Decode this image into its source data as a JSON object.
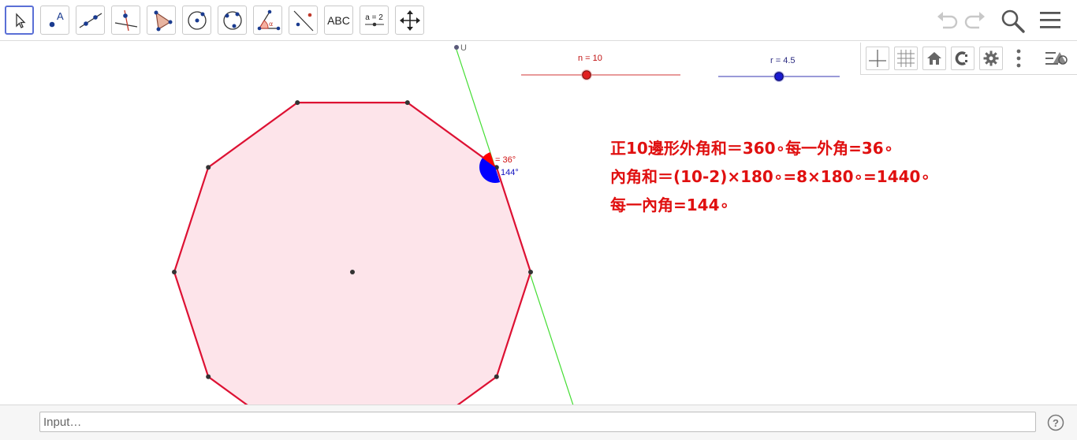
{
  "toolbar": {
    "tools": [
      {
        "name": "move-tool"
      },
      {
        "name": "point-tool",
        "glyph": "A"
      },
      {
        "name": "line-tool"
      },
      {
        "name": "perpendicular-line-tool"
      },
      {
        "name": "polygon-tool"
      },
      {
        "name": "circle-center-point-tool"
      },
      {
        "name": "circle-three-points-tool"
      },
      {
        "name": "angle-tool",
        "glyph": "α"
      },
      {
        "name": "reflect-tool"
      },
      {
        "name": "text-tool",
        "label": "ABC"
      },
      {
        "name": "slider-tool",
        "label": "a = 2"
      },
      {
        "name": "move-graphics-view-tool"
      }
    ],
    "undo_icon": "undo-icon",
    "redo_icon": "redo-icon",
    "search_icon": "search-icon",
    "menu_icon": "menu-icon"
  },
  "stylebar": {
    "buttons": [
      "axes-icon",
      "grid-icon",
      "home-icon",
      "point-capturing-icon",
      "gear-icon",
      "more-icon",
      "toggle-views-icon"
    ]
  },
  "sliders": [
    {
      "label": "n = 10",
      "value": 10,
      "color": "#e02020"
    },
    {
      "label": "r = 4.5",
      "value": 4.5,
      "color": "#1a1ad0"
    }
  ],
  "geometry": {
    "polygon_sides": 10,
    "fill_color": "#fde4ea",
    "edge_color": "#dd1133",
    "tangent_line_color": "#44dd33",
    "line_point_label": "U",
    "exterior_angle_label": "= 36°",
    "interior_angle_label": "144°",
    "exterior_angle_color": "#ff0000",
    "interior_angle_color": "#0000ff"
  },
  "notes": {
    "line1": "正10邊形外角和＝360∘每一外角=36∘",
    "line2": "內角和＝(10-2)×180∘=8×180∘=1440∘",
    "line3": "每一內角=144∘",
    "color": "#e01010"
  },
  "input_bar": {
    "placeholder": "Input…",
    "help_icon": "help-icon"
  }
}
